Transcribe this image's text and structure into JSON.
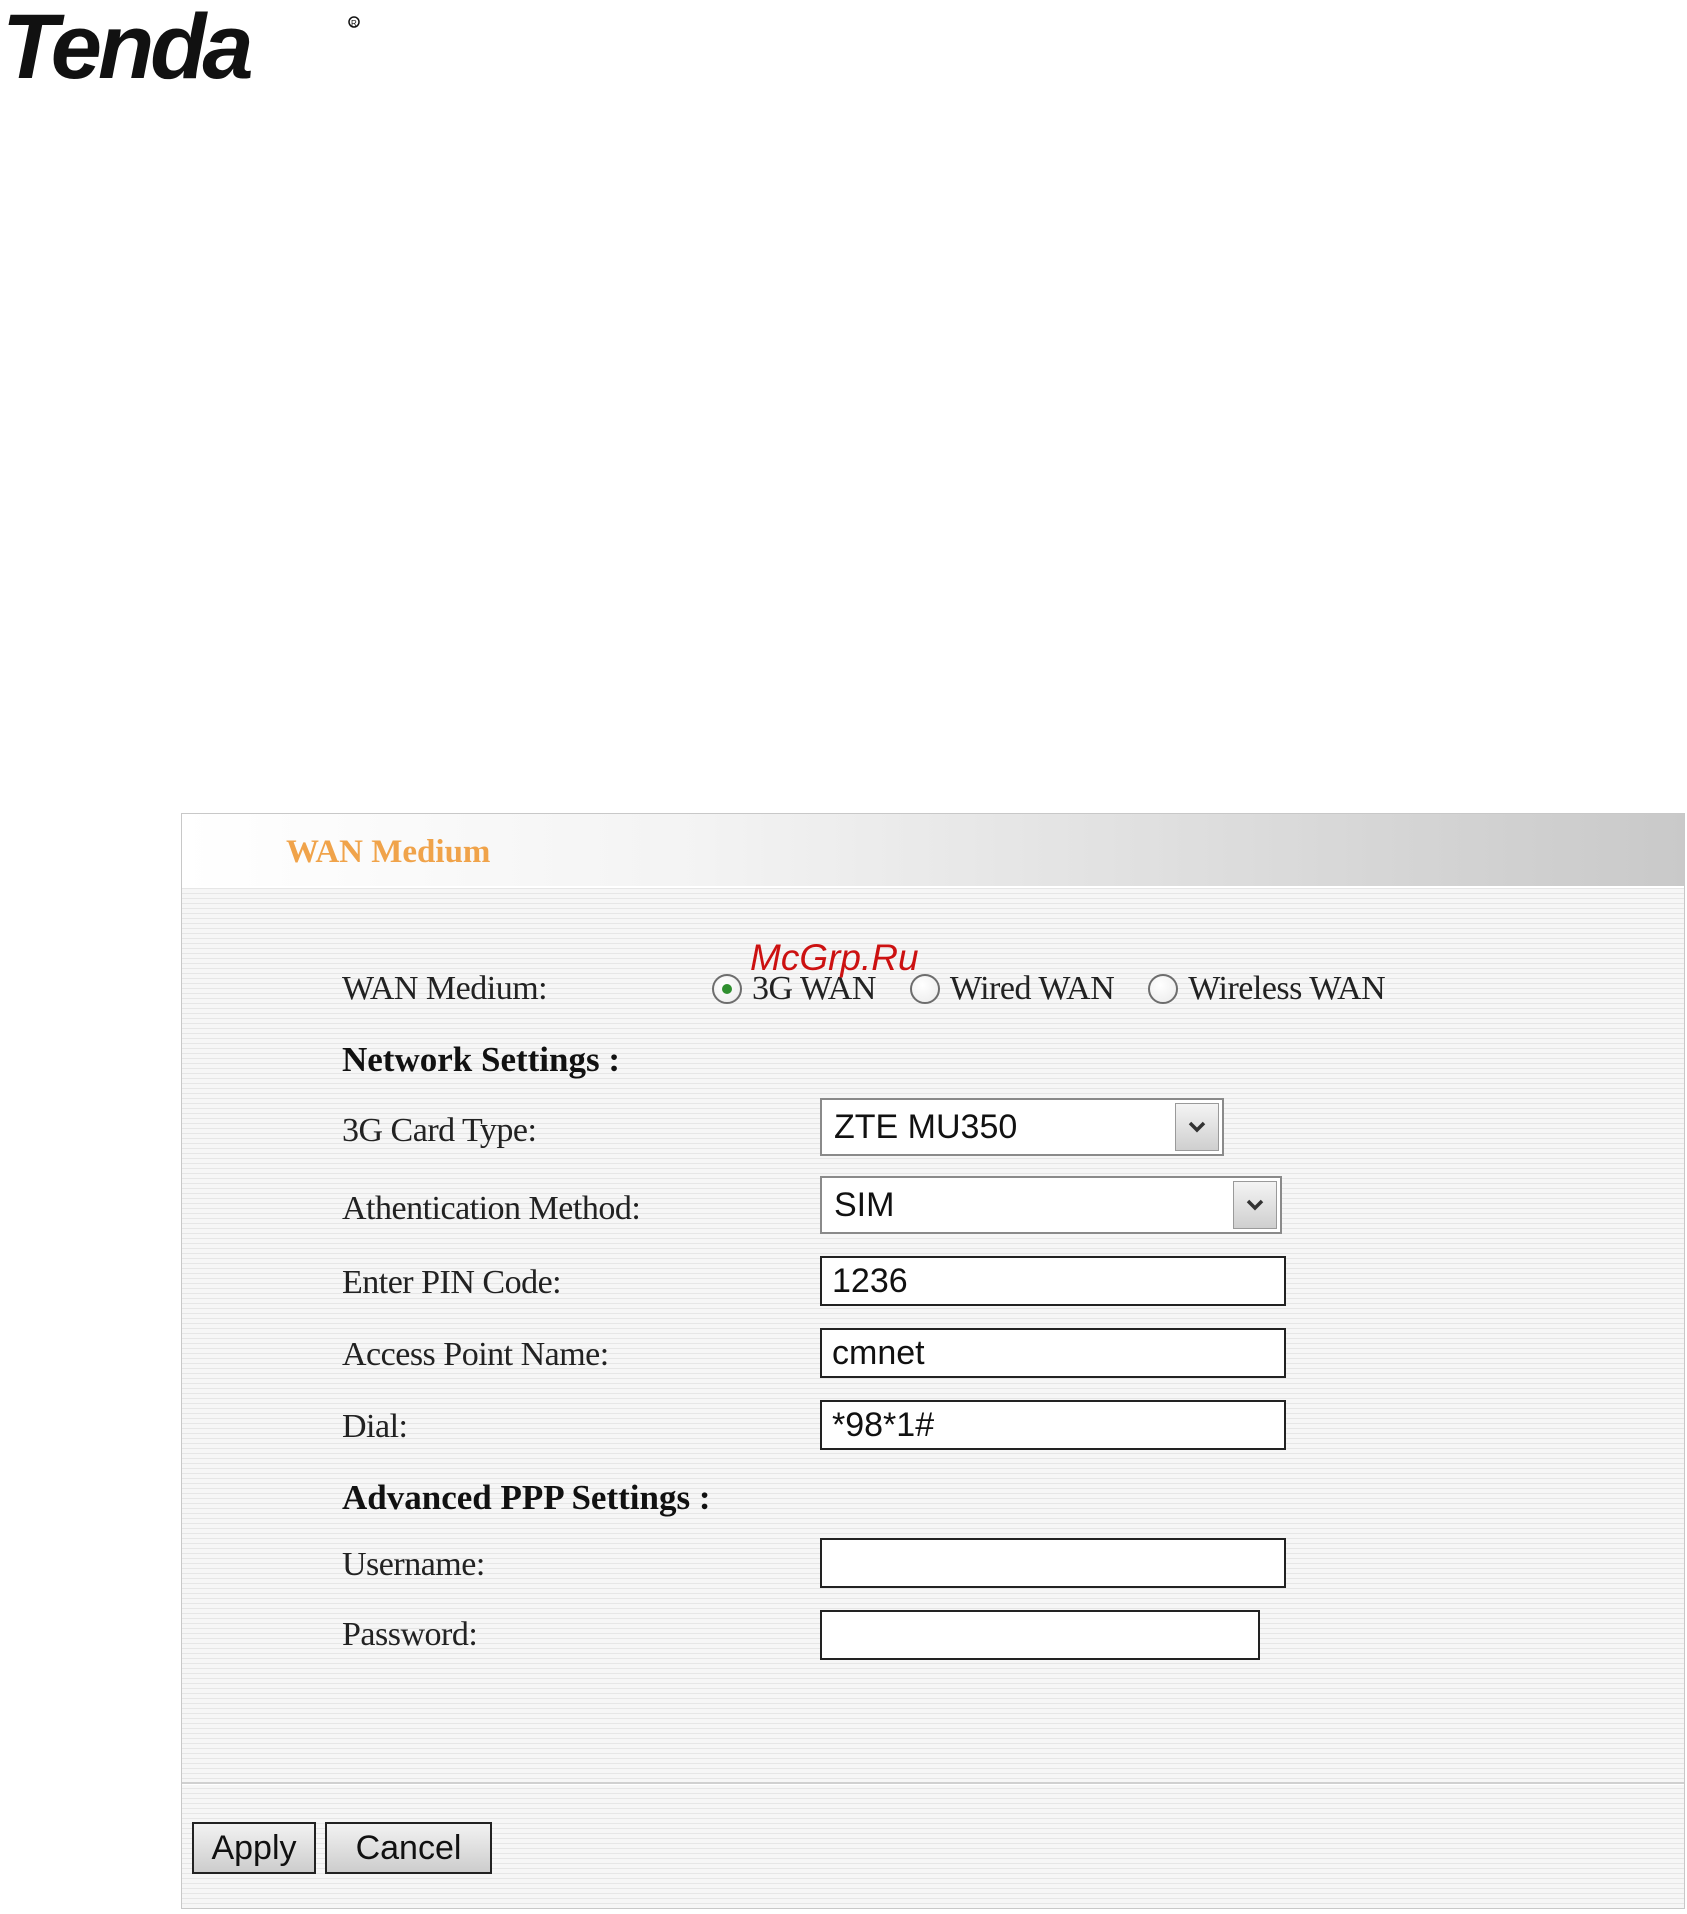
{
  "brand": {
    "logo_text": "Tenda"
  },
  "watermark": "McGrp.Ru",
  "panel": {
    "title": "WAN Medium",
    "wan_medium": {
      "label": "WAN Medium:",
      "options": [
        {
          "label": "3G WAN",
          "checked": true
        },
        {
          "label": "Wired WAN",
          "checked": false
        },
        {
          "label": "Wireless WAN",
          "checked": false
        }
      ]
    },
    "network_settings": {
      "heading": "Network Settings :",
      "card_type": {
        "label": "3G Card Type:",
        "value": "ZTE MU350"
      },
      "auth_method": {
        "label": "Athentication Method:",
        "value": "SIM"
      },
      "pin_code": {
        "label": "Enter PIN Code:",
        "value": "1236"
      },
      "apn": {
        "label": "Access Point Name:",
        "value": "cmnet"
      },
      "dial": {
        "label": "Dial:",
        "value": "*98*1#"
      }
    },
    "ppp_settings": {
      "heading": "Advanced PPP Settings :",
      "username": {
        "label": "Username:",
        "value": ""
      },
      "password": {
        "label": "Password:",
        "value": ""
      }
    },
    "buttons": {
      "apply": "Apply",
      "cancel": "Cancel"
    }
  },
  "colors": {
    "title": "#f0a34a",
    "watermark": "#cc1111",
    "radio_checked": "#2f8f2f"
  }
}
